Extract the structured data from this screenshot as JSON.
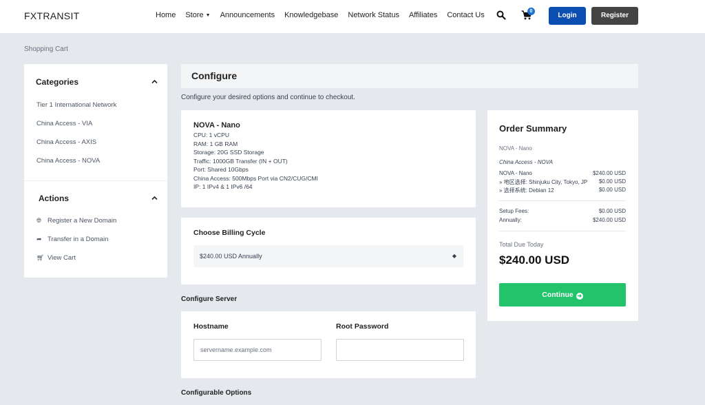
{
  "header": {
    "logo": "FXTRANSIT",
    "nav": [
      {
        "label": "Home"
      },
      {
        "label": "Store",
        "dropdown": true
      },
      {
        "label": "Announcements"
      },
      {
        "label": "Knowledgebase"
      },
      {
        "label": "Network Status"
      },
      {
        "label": "Affiliates"
      },
      {
        "label": "Contact Us"
      }
    ],
    "cart_count": "0",
    "login_label": "Login",
    "register_label": "Register"
  },
  "breadcrumb": "Shopping Cart",
  "sidebar": {
    "categories_title": "Categories",
    "categories": [
      {
        "label": "Tier 1 International Network"
      },
      {
        "label": "China Access - VIA"
      },
      {
        "label": "China Access - AXIS"
      },
      {
        "label": "China Access - NOVA"
      }
    ],
    "actions_title": "Actions",
    "actions": [
      {
        "label": "Register a New Domain",
        "icon": "globe-icon"
      },
      {
        "label": "Transfer in a Domain",
        "icon": "share-arrow-icon"
      },
      {
        "label": "View Cart",
        "icon": "cart-icon"
      }
    ]
  },
  "main": {
    "title": "Configure",
    "subtitle": "Configure your desired options and continue to checkout.",
    "product": {
      "name": "NOVA - Nano",
      "specs": [
        "CPU: 1 vCPU",
        "RAM: 1 GB RAM",
        "Storage: 20G SSD Storage",
        "Traffic: 1000GB Transfer (IN + OUT)",
        "Port: Shared 10Gbps",
        "China Access: 500Mbps Port via CN2/CUG/CMI",
        "IP: 1 IPv4 & 1 IPv6 /64"
      ]
    },
    "billing": {
      "label": "Choose Billing Cycle",
      "selected": "$240.00 USD Annually"
    },
    "configure_server_title": "Configure Server",
    "server": {
      "hostname_label": "Hostname",
      "hostname_placeholder": "servername.example.com",
      "root_password_label": "Root Password",
      "root_password_value": ""
    },
    "configurable_options_title": "Configurable Options"
  },
  "summary": {
    "title": "Order Summary",
    "product_name": "NOVA - Nano",
    "group_name": "China Access - NOVA",
    "lines": [
      {
        "label": "NOVA - Nano",
        "value": "$240.00 USD"
      },
      {
        "label": "» 地区选择: Shinjuku City, Tokyo, JP",
        "value": "$0.00 USD"
      },
      {
        "label": "» 选择系统: Debian 12",
        "value": "$0.00 USD"
      }
    ],
    "fees": [
      {
        "label": "Setup Fees:",
        "value": "$0.00 USD"
      },
      {
        "label": "Annually:",
        "value": "$240.00 USD"
      }
    ],
    "total_label": "Total Due Today",
    "total_value": "$240.00 USD",
    "continue_label": "Continue"
  },
  "colors": {
    "primary_blue": "#0b4fb3",
    "continue_green": "#22c36b",
    "page_bg": "#e5e9ed"
  }
}
